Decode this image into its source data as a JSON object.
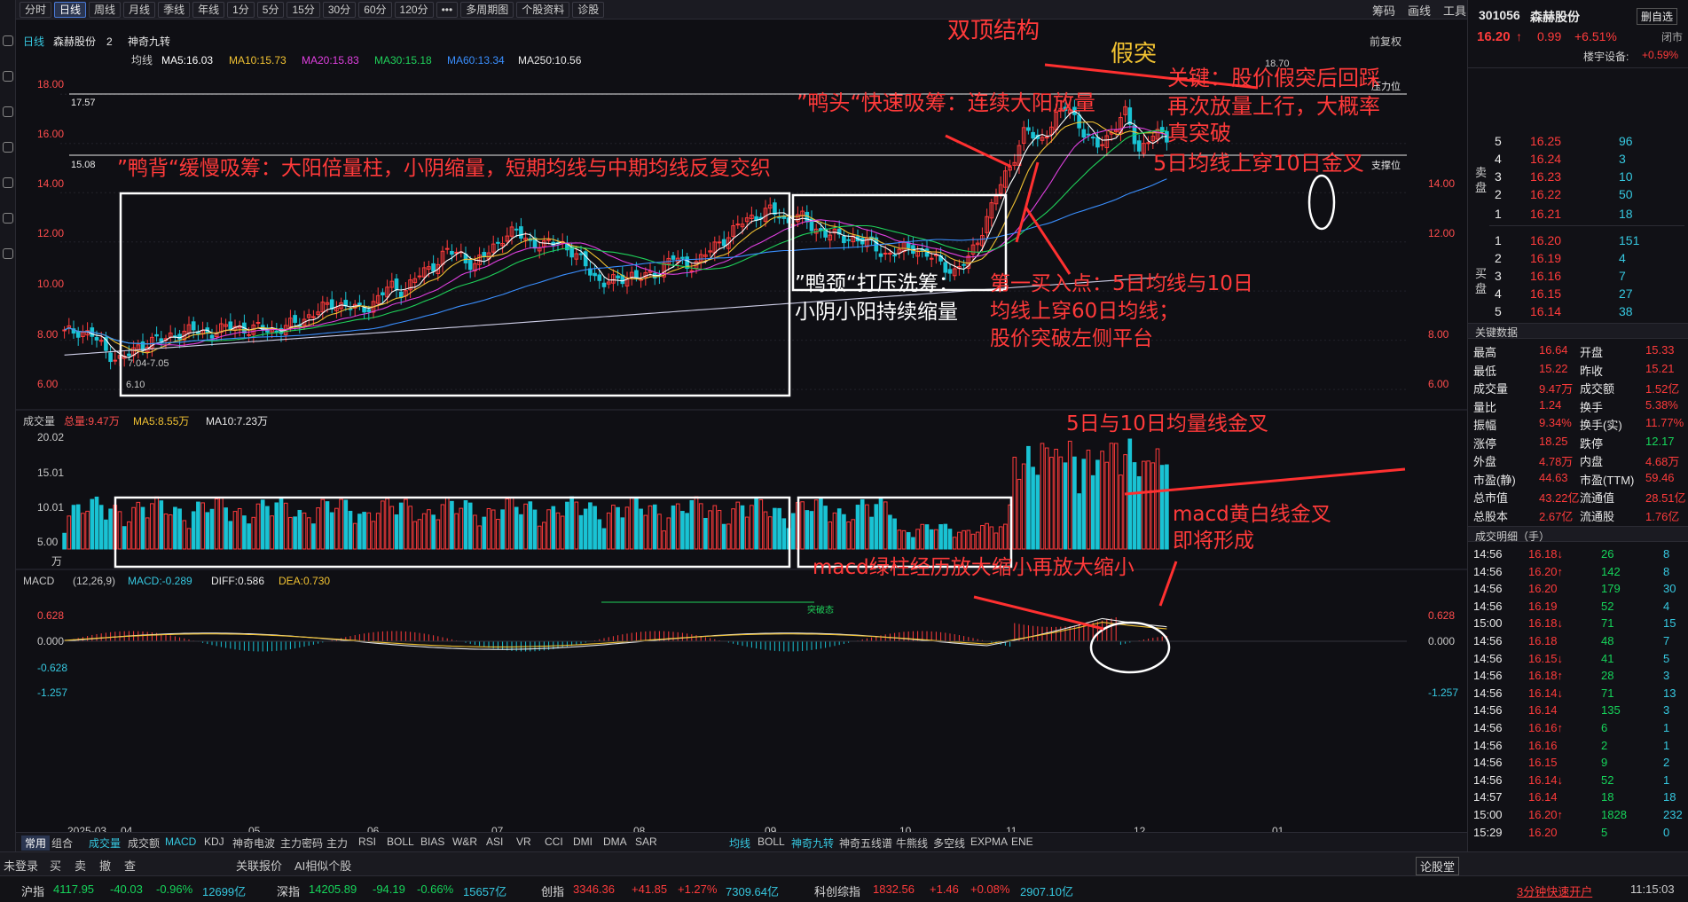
{
  "window": {
    "title": "森赫股份"
  },
  "toolbar": {
    "periods": [
      "分时",
      "日线",
      "周线",
      "月线",
      "季线",
      "年线",
      "1分",
      "5分",
      "15分",
      "30分",
      "60分",
      "120分"
    ],
    "active_period": "日线",
    "more": "•••",
    "multi_period": "多周期图",
    "stock_info": "个股资料",
    "diagnose": "诊股",
    "right_items": [
      "筹码",
      "画线",
      "工具"
    ]
  },
  "stock_bar": {
    "type": "日线",
    "name": "森赫股份",
    "count": "2",
    "indicator": "神奇九转",
    "ma_label": "均线",
    "ma5": "MA5:16.03",
    "ma10": "MA10:15.73",
    "ma20": "MA20:15.83",
    "ma30": "MA30:15.18",
    "ma60": "MA60:13.34",
    "ma250": "MA250:10.56",
    "fq": "前复权"
  },
  "price_axis": [
    "18.00",
    "16.00",
    "14.00",
    "12.00",
    "10.00",
    "8.00",
    "6.00"
  ],
  "price_marks": {
    "upper_line": "17.57",
    "lower_line": "15.08",
    "high": "18.70",
    "low": "6.10",
    "low_range": "7.04-7.05",
    "pressure": "压力位",
    "support": "支撑位"
  },
  "volume_bar": {
    "label": "成交量",
    "total": "总量:9.47万",
    "ma5": "MA5:8.55万",
    "ma10": "MA10:7.23万",
    "axis": [
      "20.02",
      "15.01",
      "10.01",
      "5.00",
      "万"
    ]
  },
  "macd_bar": {
    "label": "MACD",
    "params": "(12,26,9)",
    "macd": "MACD:-0.289",
    "diff": "DIFF:0.586",
    "dea": "DEA:0.730",
    "axis": [
      "0.628",
      "0.000",
      "-0.628",
      "-1.257"
    ],
    "small_label": "突破态"
  },
  "date_axis": [
    "2025-03",
    "04",
    "05",
    "06",
    "07",
    "08",
    "09",
    "10",
    "11",
    "12",
    "01"
  ],
  "chart_data": {
    "type": "candlestick",
    "x_ticks": [
      "2025-03",
      "04",
      "05",
      "06",
      "07",
      "08",
      "09",
      "10",
      "11",
      "12",
      "01"
    ],
    "price_ticks": [
      6.0,
      8.0,
      10.0,
      12.0,
      14.0,
      16.0,
      18.0
    ],
    "ylim_price": [
      5.5,
      19.2
    ],
    "volume_ticks": [
      5.0,
      10.01,
      15.01,
      20.02
    ],
    "volume_unit": "万",
    "macd_ticks": [
      -1.257,
      -0.628,
      0.0,
      0.628
    ],
    "ma_series": [
      {
        "name": "MA5",
        "last": 16.03,
        "color": "#ffffff"
      },
      {
        "name": "MA10",
        "last": 15.73,
        "color": "#f1c232"
      },
      {
        "name": "MA20",
        "last": 15.83,
        "color": "#e040e0"
      },
      {
        "name": "MA30",
        "last": 15.18,
        "color": "#1fd15a"
      },
      {
        "name": "MA60",
        "last": 13.34,
        "color": "#3a8fff"
      },
      {
        "name": "MA250",
        "last": 10.56,
        "color": "#cfcfe8"
      }
    ],
    "close_path": [
      8.3,
      8.4,
      8.2,
      7.5,
      7.2,
      7.6,
      8.0,
      8.0,
      8.3,
      8.4,
      8.3,
      8.4,
      8.6,
      8.4,
      8.5,
      8.4,
      8.6,
      8.9,
      9.2,
      9.5,
      9.4,
      9.2,
      9.6,
      10.2,
      10.0,
      10.6,
      11.0,
      11.6,
      11.5,
      11.0,
      11.6,
      12.2,
      12.4,
      12.0,
      11.8,
      12.1,
      11.5,
      11.0,
      10.3,
      10.4,
      10.7,
      10.5,
      10.8,
      11.4,
      11.0,
      11.3,
      11.8,
      12.3,
      12.8,
      13.1,
      13.3,
      12.8,
      13.1,
      12.5,
      12.4,
      12.1,
      12.2,
      11.9,
      11.5,
      11.6,
      11.8,
      11.5,
      11.1,
      10.8,
      11.3,
      12.6,
      14.0,
      15.2,
      16.6,
      16.0,
      17.0,
      17.5,
      16.6,
      15.8,
      16.4,
      17.3,
      15.7,
      16.4,
      16.2
    ]
  },
  "annotations": {
    "double_top": "双顶结构",
    "fake_break": "假突",
    "duck_head": "”鸭头“快速吸筹：连续大阳放量",
    "duck_back": "”鸭背“缓慢吸筹：大阳倍量柱，小阴缩量，短期均线与中期均线反复交织",
    "duck_neck_1": "”鸭颈“打压洗筹：",
    "duck_neck_2": "小阴小阳持续缩量",
    "buy1_1": "第一买入点：5日均线与10日",
    "buy1_2": "均线上穿60日均线；",
    "buy1_3": "股价突破左侧平台",
    "key_1": "关键：股价假突后回踩",
    "key_2": "再次放量上行，大概率",
    "key_3": "真突破",
    "ma_cross": "5日均线上穿10日金叉",
    "vol_cross": "5日与10日均量线金叉",
    "macd_green": "macd绿柱经历放大缩小再放大缩小",
    "macd_cross_1": "macd黄白线金叉",
    "macd_cross_2": "即将形成"
  },
  "right_panel": {
    "code": "301056",
    "name": "森赫股份",
    "price": "16.20",
    "arrow": "↑",
    "change": "0.99",
    "pct": "+6.51%",
    "delete": "删自选",
    "close": "闭市",
    "settings": "楼宇设备:",
    "sector_pct": "+0.59%",
    "sell_label": "卖盘",
    "buy_label": "买盘",
    "asks": [
      {
        "n": "5",
        "p": "16.25",
        "v": "96"
      },
      {
        "n": "4",
        "p": "16.24",
        "v": "3"
      },
      {
        "n": "3",
        "p": "16.23",
        "v": "10"
      },
      {
        "n": "2",
        "p": "16.22",
        "v": "50"
      },
      {
        "n": "1",
        "p": "16.21",
        "v": "18"
      }
    ],
    "bids": [
      {
        "n": "1",
        "p": "16.20",
        "v": "151"
      },
      {
        "n": "2",
        "p": "16.19",
        "v": "4"
      },
      {
        "n": "3",
        "p": "16.16",
        "v": "7"
      },
      {
        "n": "4",
        "p": "16.15",
        "v": "27"
      },
      {
        "n": "5",
        "p": "16.14",
        "v": "38"
      }
    ],
    "quote_title": "关键数据",
    "quote": [
      [
        "最高",
        "16.64",
        "开盘",
        "15.33"
      ],
      [
        "最低",
        "15.22",
        "昨收",
        "15.21"
      ],
      [
        "成交量",
        "9.47万",
        "成交额",
        "1.52亿"
      ],
      [
        "量比",
        "1.24",
        "换手",
        "5.38%"
      ],
      [
        "振幅",
        "9.34%",
        "换手(实)",
        "11.77%"
      ],
      [
        "涨停",
        "18.25",
        "跌停",
        "12.17"
      ],
      [
        "外盘",
        "4.78万",
        "内盘",
        "4.68万"
      ],
      [
        "市盈(静)",
        "44.63",
        "市盈(TTM)",
        "59.46"
      ],
      [
        "总市值",
        "43.22亿",
        "流通值",
        "28.51亿"
      ],
      [
        "总股本",
        "2.67亿",
        "流通股",
        "1.76亿"
      ]
    ],
    "ticks_title": "成交明细（手）",
    "ticks": [
      [
        "14:56",
        "16.18",
        "↓",
        "26",
        "8"
      ],
      [
        "14:56",
        "16.20",
        "↑",
        "142",
        "8"
      ],
      [
        "14:56",
        "16.20",
        "",
        "179",
        "30"
      ],
      [
        "14:56",
        "16.19",
        "",
        "52",
        "4"
      ],
      [
        "15:00",
        "16.18",
        "↓",
        "71",
        "15"
      ],
      [
        "14:56",
        "16.18",
        "",
        "48",
        "7"
      ],
      [
        "14:56",
        "16.15",
        "↓",
        "41",
        "5"
      ],
      [
        "14:56",
        "16.18",
        "↑",
        "28",
        "3"
      ],
      [
        "14:56",
        "16.14",
        "↓",
        "71",
        "13"
      ],
      [
        "14:56",
        "16.14",
        "",
        "135",
        "3"
      ],
      [
        "14:56",
        "16.16",
        "↑",
        "6",
        "1"
      ],
      [
        "14:56",
        "16.16",
        "",
        "2",
        "1"
      ],
      [
        "14:56",
        "16.15",
        "",
        "9",
        "2"
      ],
      [
        "14:56",
        "16.14",
        "↓",
        "52",
        "1"
      ],
      [
        "14:57",
        "16.14",
        "",
        "18",
        "18"
      ],
      [
        "15:00",
        "16.20",
        "↑",
        "1828",
        "232"
      ],
      [
        "15:29",
        "16.20",
        "",
        "5",
        "0"
      ]
    ]
  },
  "bottom_tabs": {
    "left": [
      "常用",
      "组合",
      "成交量",
      "成交额",
      "MACD",
      "KDJ",
      "神奇电波",
      "主力密码",
      "主力",
      "RSI",
      "BOLL",
      "BIAS",
      "W&R",
      "ASI",
      "VR",
      "CCI",
      "DMI",
      "DMA",
      "SAR"
    ],
    "right": [
      "均线",
      "BOLL",
      "神奇九转",
      "神奇五线谱",
      "牛熊线",
      "多空线",
      "EXPMA",
      "ENE"
    ]
  },
  "minibar": {
    "items": [
      "未登录",
      "买",
      "卖",
      "撤",
      "查",
      "关联报价",
      "AI相似个股",
      "论股堂"
    ]
  },
  "statusbar": {
    "sh": {
      "name": "沪指",
      "val": "4117.95",
      "chg": "-40.03",
      "pct": "-0.96%",
      "amt": "12699亿"
    },
    "sz": {
      "name": "深指",
      "val": "14205.89",
      "chg": "-94.19",
      "pct": "-0.66%",
      "amt": "15657亿"
    },
    "cy": {
      "name": "创指",
      "val": "3346.36",
      "chg": "+41.85",
      "pct": "+1.27%",
      "amt": "7309.64亿"
    },
    "kc": {
      "name": "科创综指",
      "val": "1832.56",
      "chg": "+1.46",
      "pct": "+0.08%",
      "amt": "2907.10亿"
    },
    "promo": "3分钟快速开户",
    "time": "11:15:03"
  }
}
